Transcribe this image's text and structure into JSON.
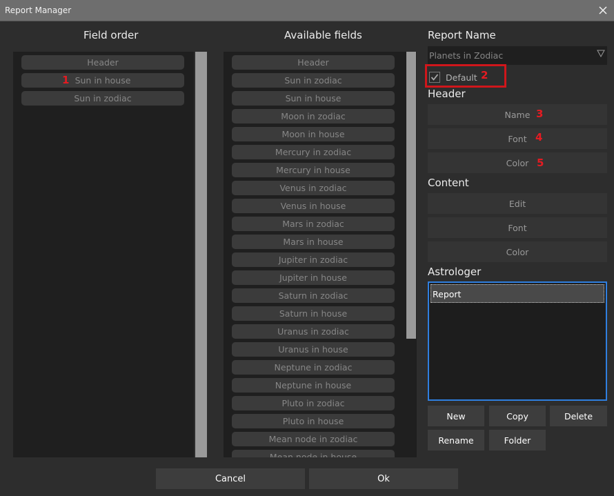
{
  "window": {
    "title": "Report Manager",
    "close_icon": "close-icon"
  },
  "field_order": {
    "title": "Field order",
    "items": [
      "Header",
      "Sun in house",
      "Sun in zodiac"
    ]
  },
  "available": {
    "title": "Available fields",
    "items": [
      "Header",
      "Sun in zodiac",
      "Sun in house",
      "Moon in zodiac",
      "Moon in house",
      "Mercury in zodiac",
      "Mercury in house",
      "Venus in zodiac",
      "Venus in house",
      "Mars in zodiac",
      "Mars in house",
      "Jupiter in zodiac",
      "Jupiter in house",
      "Saturn in zodiac",
      "Saturn in house",
      "Uranus in zodiac",
      "Uranus in house",
      "Neptune in zodiac",
      "Neptune in house",
      "Pluto in zodiac",
      "Pluto in house",
      "Mean node in zodiac",
      "Mean node in house"
    ]
  },
  "report": {
    "name_title": "Report Name",
    "name_value": "Planets in Zodiac",
    "default_label": "Default",
    "default_checked": true
  },
  "header": {
    "title": "Header",
    "name": "Name",
    "font": "Font",
    "color": "Color"
  },
  "content": {
    "title": "Content",
    "edit": "Edit",
    "font": "Font",
    "color": "Color"
  },
  "astrologer": {
    "title": "Astrologer",
    "items": [
      "Report"
    ]
  },
  "actions": {
    "new": "New",
    "copy": "Copy",
    "delete": "Delete",
    "rename": "Rename",
    "folder": "Folder"
  },
  "footer": {
    "cancel": "Cancel",
    "ok": "Ok"
  },
  "annotations": {
    "n1": "1",
    "n2": "2",
    "n3": "3",
    "n4": "4",
    "n5": "5"
  },
  "colors": {
    "annotation_red": "#e51b22",
    "selection_blue": "#2f7fe0"
  }
}
